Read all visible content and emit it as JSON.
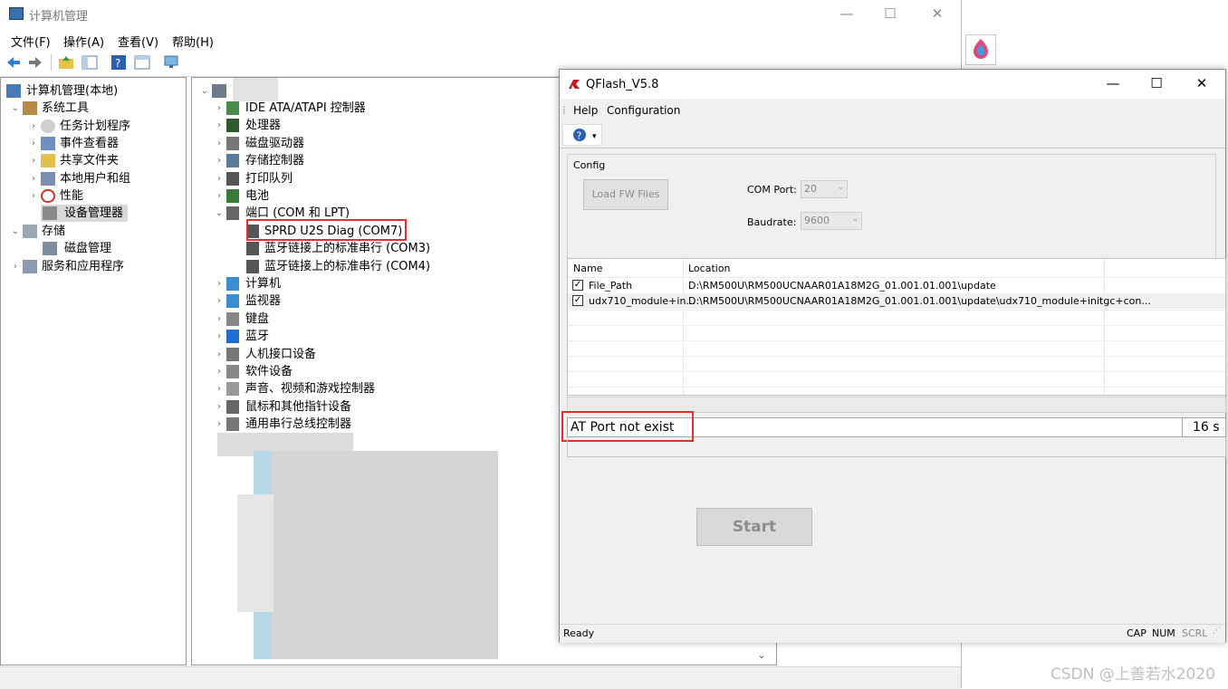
{
  "computer_management": {
    "title": "计算机管理",
    "menu": [
      "文件(F)",
      "操作(A)",
      "查看(V)",
      "帮助(H)"
    ],
    "window_controls": {
      "minimize": "—",
      "maximize": "☐",
      "close": "✕"
    },
    "left_tree": [
      {
        "label": "计算机管理(本地)",
        "icon": "computer-management-icon"
      },
      {
        "label": "系统工具",
        "icon": "tools-icon"
      },
      {
        "label": "任务计划程序",
        "icon": "clock-icon"
      },
      {
        "label": "事件查看器",
        "icon": "event-viewer-icon"
      },
      {
        "label": "共享文件夹",
        "icon": "shared-folder-icon"
      },
      {
        "label": "本地用户和组",
        "icon": "users-icon"
      },
      {
        "label": "性能",
        "icon": "performance-icon"
      },
      {
        "label": "设备管理器",
        "icon": "device-manager-icon"
      },
      {
        "label": "存储",
        "icon": "storage-icon"
      },
      {
        "label": "磁盘管理",
        "icon": "disk-management-icon"
      },
      {
        "label": "服务和应用程序",
        "icon": "services-icon"
      }
    ],
    "device_tree": [
      {
        "label": "IDE ATA/ATAPI 控制器",
        "icon": "ide-controller-icon"
      },
      {
        "label": "处理器",
        "icon": "processor-icon"
      },
      {
        "label": "磁盘驱动器",
        "icon": "disk-drive-icon"
      },
      {
        "label": "存储控制器",
        "icon": "storage-controller-icon"
      },
      {
        "label": "打印队列",
        "icon": "printer-icon"
      },
      {
        "label": "电池",
        "icon": "battery-icon"
      },
      {
        "label": "端口 (COM 和 LPT)",
        "icon": "port-icon"
      },
      {
        "label": "SPRD U2S Diag (COM7)",
        "icon": "port-device-icon"
      },
      {
        "label": "蓝牙链接上的标准串行 (COM3)",
        "icon": "port-device-icon"
      },
      {
        "label": "蓝牙链接上的标准串行 (COM4)",
        "icon": "port-device-icon"
      },
      {
        "label": "计算机",
        "icon": "computer-icon"
      },
      {
        "label": "监视器",
        "icon": "monitor-icon"
      },
      {
        "label": "键盘",
        "icon": "keyboard-icon"
      },
      {
        "label": "蓝牙",
        "icon": "bluetooth-icon"
      },
      {
        "label": "人机接口设备",
        "icon": "hid-icon"
      },
      {
        "label": "软件设备",
        "icon": "software-device-icon"
      },
      {
        "label": "声音、视频和游戏控制器",
        "icon": "audio-icon"
      },
      {
        "label": "鼠标和其他指针设备",
        "icon": "mouse-icon"
      },
      {
        "label": "通用串行总线控制器",
        "icon": "usb-icon"
      }
    ]
  },
  "qflash": {
    "title": "QFlash_V5.8",
    "window_controls": {
      "minimize": "—",
      "maximize": "☐",
      "close": "✕"
    },
    "menu": [
      "Help",
      "Configuration"
    ],
    "config": {
      "group_label": "Config",
      "load_button": "Load FW Files",
      "com_port_label": "COM Port:",
      "com_port_value": "20",
      "baudrate_label": "Baudrate:",
      "baudrate_value": "9600"
    },
    "table": {
      "columns": [
        "Name",
        "Location"
      ],
      "rows": [
        {
          "checked": true,
          "name": "File_Path",
          "location": "D:\\RM500U\\RM500UCNAAR01A18M2G_01.001.01.001\\update"
        },
        {
          "checked": true,
          "name": "udx710_module+in...",
          "location": "D:\\RM500U\\RM500UCNAAR01A18M2G_01.001.01.001\\update\\udx710_module+initgc+con..."
        }
      ]
    },
    "status_message": "AT Port not exist",
    "timer": "16 s",
    "start_button": "Start",
    "statusbar": {
      "left": "Ready",
      "caps": "CAP",
      "num": "NUM",
      "scrl": "SCRL"
    }
  },
  "watermark": "CSDN @上善若水2020",
  "colors": {
    "highlight_box": "#e3302f",
    "selected_row": "#d9d9d9",
    "disabled_text": "#8a8a8a"
  }
}
